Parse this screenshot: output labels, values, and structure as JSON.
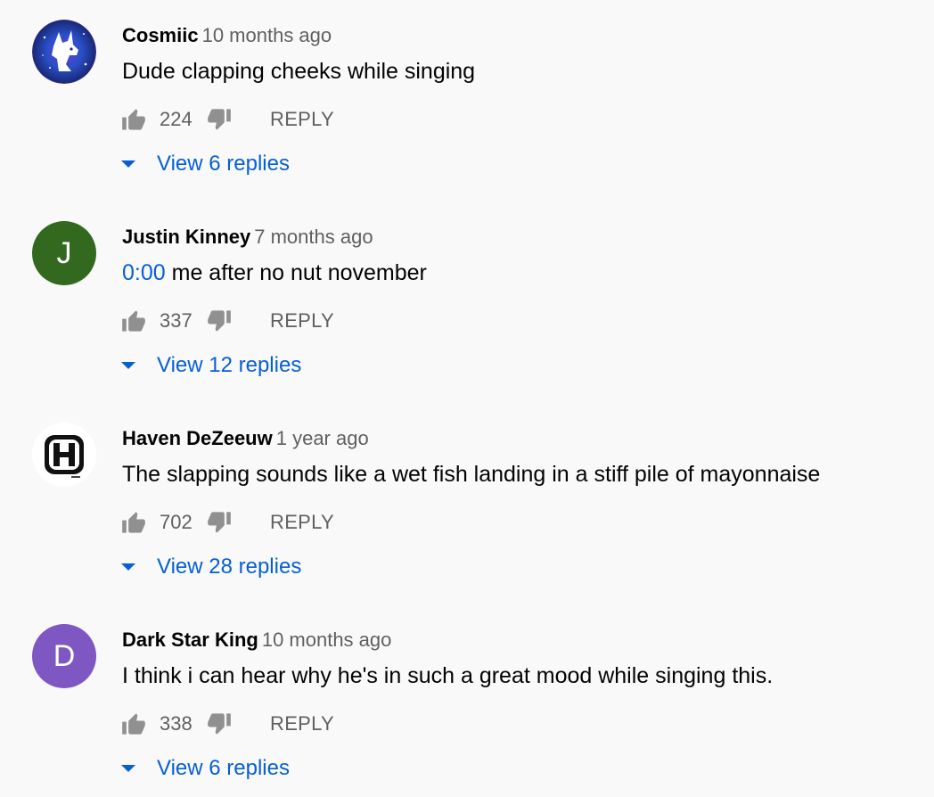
{
  "colors": {
    "background": "#f9f9f9",
    "author": "#030303",
    "meta": "#606060",
    "link": "#065fd4"
  },
  "actions": {
    "reply_label": "REPLY",
    "like_icon": "thumb-up-icon",
    "dislike_icon": "thumb-down-icon",
    "expand_icon": "caret-down-icon"
  },
  "comments": [
    {
      "author": "Cosmiic",
      "time": "10 months ago",
      "timestamp_link": "",
      "text": "Dude clapping cheeks while singing",
      "likes": "224",
      "replies_label": "View 6 replies",
      "avatar": {
        "type": "image",
        "icon": "wolf-galaxy-avatar",
        "color": "#1b3d8f"
      }
    },
    {
      "author": "Justin Kinney",
      "time": "7 months ago",
      "timestamp_link": "0:00",
      "text": " me after no nut november",
      "likes": "337",
      "replies_label": "View 12 replies",
      "avatar": {
        "type": "letter",
        "letter": "J",
        "color": "#33691e"
      }
    },
    {
      "author": "Haven DeZeeuw",
      "time": "1 year ago",
      "timestamp_link": "",
      "text": "The slapping sounds like a wet fish landing in a stiff pile of mayonnaise",
      "likes": "702",
      "replies_label": "View 28 replies",
      "avatar": {
        "type": "image",
        "icon": "h-logo-avatar",
        "color": "#ffffff"
      }
    },
    {
      "author": "Dark Star King",
      "time": "10 months ago",
      "timestamp_link": "",
      "text": "I think i can hear why he's in such a great mood while singing this.",
      "likes": "338",
      "replies_label": "View 6 replies",
      "avatar": {
        "type": "letter",
        "letter": "D",
        "color": "#7e57c2"
      }
    }
  ]
}
